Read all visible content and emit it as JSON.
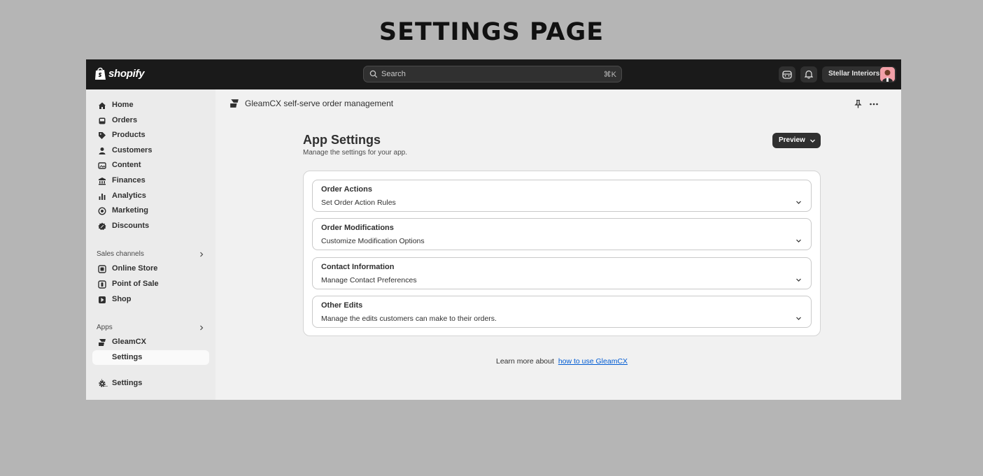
{
  "banner": {
    "title": "SETTINGS PAGE"
  },
  "topbar": {
    "brand": "shopify",
    "search_placeholder": "Search",
    "search_shortcut": "⌘K",
    "store_name": "Stellar Interiors"
  },
  "sidebar": {
    "main_items": [
      {
        "label": "Home",
        "icon": "home-icon"
      },
      {
        "label": "Orders",
        "icon": "inbox-icon"
      },
      {
        "label": "Products",
        "icon": "tag-icon"
      },
      {
        "label": "Customers",
        "icon": "person-icon"
      },
      {
        "label": "Content",
        "icon": "content-icon"
      },
      {
        "label": "Finances",
        "icon": "bank-icon"
      },
      {
        "label": "Analytics",
        "icon": "bar-chart-icon"
      },
      {
        "label": "Marketing",
        "icon": "target-icon"
      },
      {
        "label": "Discounts",
        "icon": "discount-icon"
      }
    ],
    "sales_channels_label": "Sales channels",
    "sales_channels": [
      {
        "label": "Online Store",
        "icon": "store-icon"
      },
      {
        "label": "Point of Sale",
        "icon": "pos-icon"
      },
      {
        "label": "Shop",
        "icon": "shop-icon"
      }
    ],
    "apps_label": "Apps",
    "apps": [
      {
        "label": "GleamCX",
        "icon": "gleamcx-icon"
      },
      {
        "label": "Settings",
        "icon": ""
      }
    ],
    "settings_label": "Settings"
  },
  "main": {
    "app_title": "GleamCX self-serve order management",
    "page_title": "App Settings",
    "page_subtitle": "Manage the settings for your app.",
    "preview_label": "Preview",
    "accordions": [
      {
        "title": "Order Actions",
        "subtitle": "Set Order Action Rules"
      },
      {
        "title": "Order Modifications",
        "subtitle": "Customize Modification Options"
      },
      {
        "title": "Contact Information",
        "subtitle": "Manage Contact Preferences"
      },
      {
        "title": "Other Edits",
        "subtitle": "Manage the edits customers can make to their orders."
      }
    ],
    "learn_prefix": "Learn more about",
    "learn_link": "how to use GleamCX"
  },
  "colors": {
    "topbar": "#1a1a1a",
    "sidebar": "#ebebeb",
    "link": "#005bd3",
    "primary_button": "#303030"
  }
}
